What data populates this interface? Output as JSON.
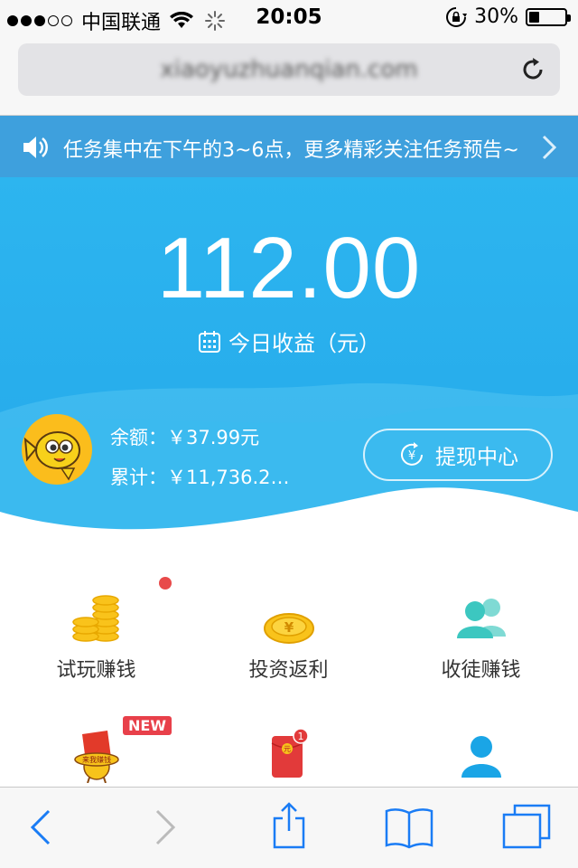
{
  "status_bar": {
    "carrier": "中国联通",
    "time": "20:05",
    "battery": "30%",
    "battery_level": 0.3,
    "signal_bars": 3,
    "signal_total": 5
  },
  "browser": {
    "url": "xiaoyuzhuanqian.com"
  },
  "notice": {
    "text": "任务集中在下午的3~6点，更多精彩关注任务预告~"
  },
  "hero": {
    "amount": "112.00",
    "label": "今日收益（元）",
    "balance": "余额：￥37.99元",
    "total": "累计：￥11,736.2…",
    "withdraw_label": "提现中心"
  },
  "grid": {
    "items": [
      {
        "label": "试玩赚钱"
      },
      {
        "label": "投资返利"
      },
      {
        "label": "收徒赚钱"
      }
    ],
    "row2_badge": "NEW",
    "row2_mascot_text": "来我赚钱",
    "row2_redpacket_count": "1",
    "row2_redpacket_text": "元"
  },
  "colors": {
    "primary": "#2db5ef",
    "notice_bg": "#3ea0dd",
    "coin": "#fbbd1c",
    "teal": "#3cc7c0",
    "red": "#e84a4a",
    "ios_blue": "#1a7cf5"
  }
}
